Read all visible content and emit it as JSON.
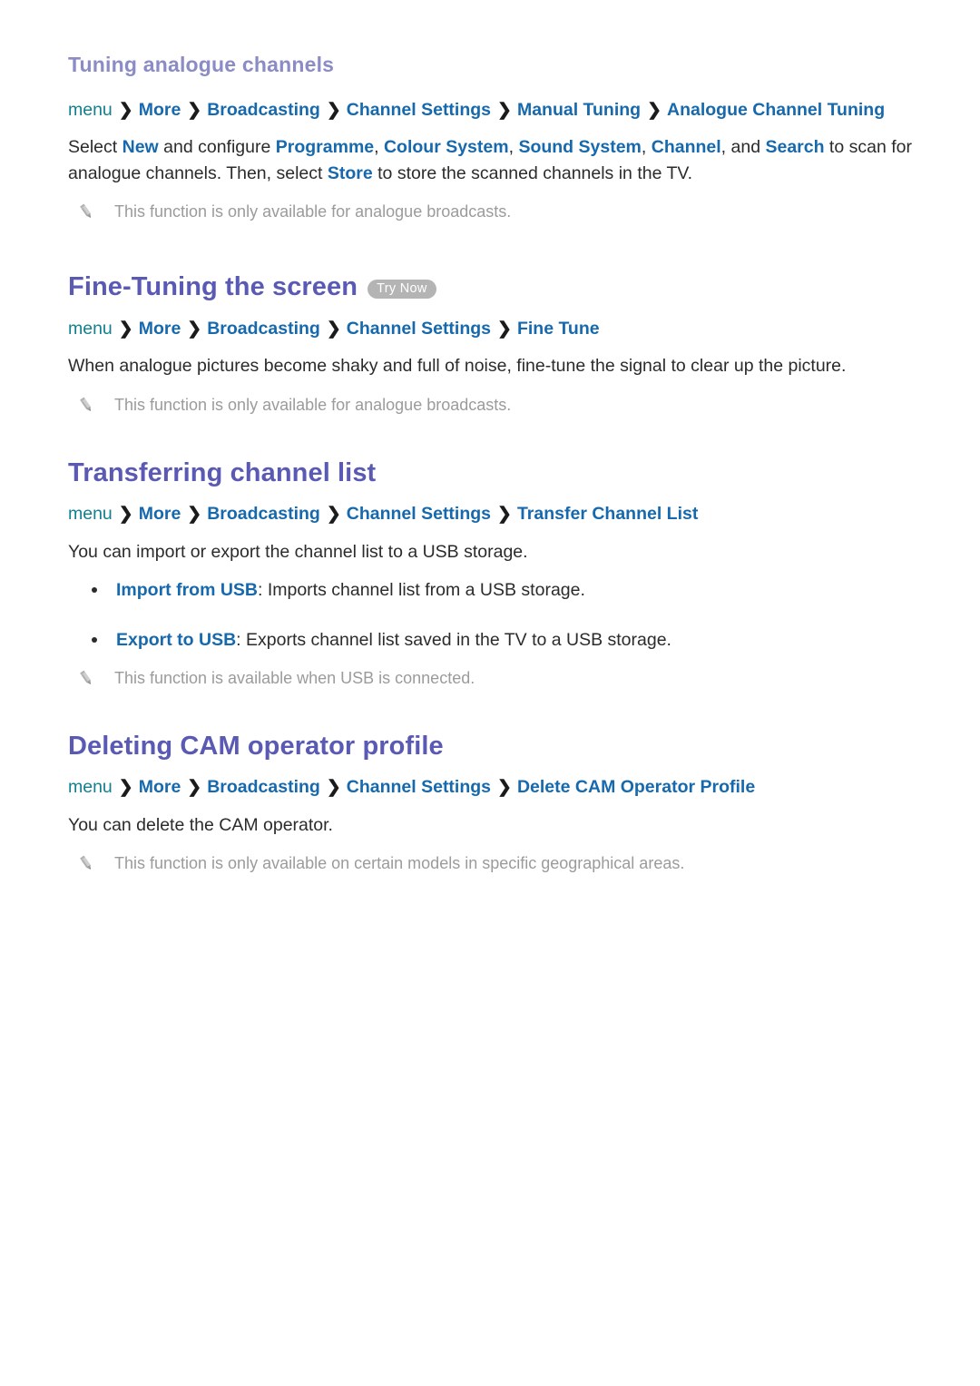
{
  "document": {
    "title": "TV e-Manual — Channel Settings"
  },
  "sections": [
    {
      "id": "tuning-analogue-channels",
      "heading": "Tuning analogue channels",
      "heading_level": "sub",
      "try_now": false,
      "breadcrumb": [
        "menu",
        "More",
        "Broadcasting",
        "Channel Settings",
        "Manual Tuning",
        "Analogue Channel Tuning"
      ],
      "separator": "❯",
      "paragraph_runs": [
        {
          "text": "Select ",
          "kw": false
        },
        {
          "text": "New",
          "kw": true
        },
        {
          "text": " and configure ",
          "kw": false
        },
        {
          "text": "Programme",
          "kw": true
        },
        {
          "text": ", ",
          "kw": false
        },
        {
          "text": "Colour System",
          "kw": true
        },
        {
          "text": ", ",
          "kw": false
        },
        {
          "text": "Sound System",
          "kw": true
        },
        {
          "text": ", ",
          "kw": false
        },
        {
          "text": "Channel",
          "kw": true
        },
        {
          "text": ", and ",
          "kw": false
        },
        {
          "text": "Search",
          "kw": true
        },
        {
          "text": " to scan for analogue channels. Then, select ",
          "kw": false
        },
        {
          "text": "Store",
          "kw": true
        },
        {
          "text": " to store the scanned channels in the TV.",
          "kw": false
        }
      ],
      "bullets": [],
      "note": "This function is only available for analogue broadcasts."
    },
    {
      "id": "fine-tuning-the-screen",
      "heading": "Fine-Tuning the screen",
      "heading_level": "main",
      "try_now": true,
      "try_now_label": "Try Now",
      "breadcrumb": [
        "menu",
        "More",
        "Broadcasting",
        "Channel Settings",
        "Fine Tune"
      ],
      "separator": "❯",
      "paragraph_runs": [
        {
          "text": "When analogue pictures become shaky and full of noise, fine-tune the signal to clear up the picture.",
          "kw": false
        }
      ],
      "bullets": [],
      "note": "This function is only available for analogue broadcasts."
    },
    {
      "id": "transferring-channel-list",
      "heading": "Transferring channel list",
      "heading_level": "main",
      "try_now": false,
      "breadcrumb": [
        "menu",
        "More",
        "Broadcasting",
        "Channel Settings",
        "Transfer Channel List"
      ],
      "separator": "❯",
      "paragraph_runs": [
        {
          "text": "You can import or export the channel list to a USB storage.",
          "kw": false
        }
      ],
      "bullets": [
        {
          "term": "Import from USB",
          "desc": ": Imports channel list from a USB storage."
        },
        {
          "term": "Export to USB",
          "desc": ": Exports channel list saved in the TV to a USB storage."
        }
      ],
      "note": "This function is available when USB is connected."
    },
    {
      "id": "deleting-cam-operator-profile",
      "heading": "Deleting CAM operator profile",
      "heading_level": "main",
      "try_now": false,
      "breadcrumb": [
        "menu",
        "More",
        "Broadcasting",
        "Channel Settings",
        "Delete CAM Operator Profile"
      ],
      "separator": "❯",
      "paragraph_runs": [
        {
          "text": "You can delete the CAM operator.",
          "kw": false
        }
      ],
      "bullets": [],
      "note": "This function is only available on certain models in specific geographical areas."
    }
  ],
  "icons": {
    "note_icon": "pencil-icon"
  },
  "colors": {
    "sub_heading": "#8b8bc6",
    "main_heading": "#5a5ab4",
    "breadcrumb_first": "#11808f",
    "breadcrumb_link": "#1769ad",
    "keyword": "#1769ad",
    "body_text": "#2b2b2b",
    "note_text": "#9b9b9b",
    "try_now_bg": "#b4b4b4",
    "try_now_text": "#ffffff",
    "page_bg": "#ffffff"
  }
}
